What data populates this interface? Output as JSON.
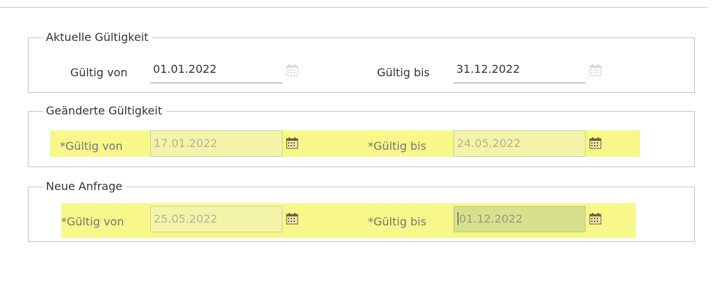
{
  "sections": [
    {
      "legend": "Aktuelle Gültigkeit",
      "from": {
        "label": "Gültig von",
        "required": false,
        "value": "01.01.2022"
      },
      "to": {
        "label": "Gültig bis",
        "required": false,
        "value": "31.12.2022"
      }
    },
    {
      "legend": "Geänderte Gültigkeit",
      "from": {
        "label": "Gültig von",
        "required": true,
        "value": "17.01.2022"
      },
      "to": {
        "label": "Gültig bis",
        "required": true,
        "value": "24.05.2022"
      }
    },
    {
      "legend": "Neue Anfrage",
      "from": {
        "label": "Gültig von",
        "required": true,
        "value": "25.05.2022"
      },
      "to": {
        "label": "Gültig bis",
        "required": true,
        "value": "01.12.2022"
      }
    }
  ],
  "required_marker": "*",
  "icons": {
    "calendar": "calendar-icon"
  },
  "colors": {
    "highlight": "#f7f78a",
    "focused_field": "#d6e18d",
    "border": "#c4c4c4"
  }
}
